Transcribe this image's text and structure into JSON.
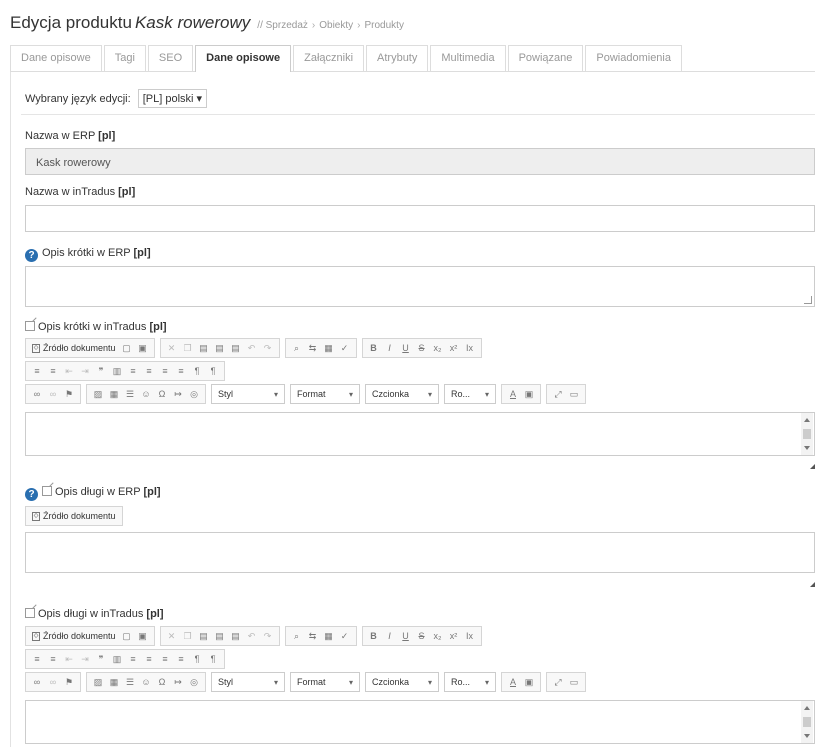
{
  "title": {
    "prefix": "Edycja produktu",
    "product": "Kask rowerowy",
    "sep": "//",
    "crumbs": [
      "Sprzedaż",
      "Obiekty",
      "Produkty"
    ]
  },
  "tabs": [
    {
      "label": "Dane opisowe"
    },
    {
      "label": "Tagi"
    },
    {
      "label": "SEO"
    },
    {
      "label": "Dane opisowe",
      "active": true
    },
    {
      "label": "Załączniki"
    },
    {
      "label": "Atrybuty"
    },
    {
      "label": "Multimedia"
    },
    {
      "label": "Powiązane"
    },
    {
      "label": "Powiadomienia"
    }
  ],
  "language": {
    "label": "Wybrany język edycji:",
    "value": "[PL] polski"
  },
  "fields": {
    "erp_name": {
      "label": "Nazwa w ERP",
      "lang": "[pl]",
      "value": "Kask rowerowy"
    },
    "intradus_name": {
      "label": "Nazwa w inTradus",
      "lang": "[pl]",
      "value": ""
    },
    "short_erp": {
      "label": "Opis krótki w ERP",
      "lang": "[pl]",
      "value": ""
    },
    "short_intradus": {
      "label": "Opis krótki w inTradus",
      "lang": "[pl]",
      "value": ""
    },
    "long_erp": {
      "label": "Opis długi w ERP",
      "lang": "[pl]",
      "value": ""
    },
    "long_intradus": {
      "label": "Opis długi w inTradus",
      "lang": "[pl]",
      "value": ""
    }
  },
  "editor": {
    "source_label": "Źródło dokumentu",
    "style_label": "Styl",
    "format_label": "Format",
    "font_label": "Czcionka",
    "size_label": "Ro...",
    "arrow": "▾"
  },
  "icons": {
    "help": "?",
    "help_name": "question-circle-icon",
    "edit_name": "edit-icon"
  }
}
